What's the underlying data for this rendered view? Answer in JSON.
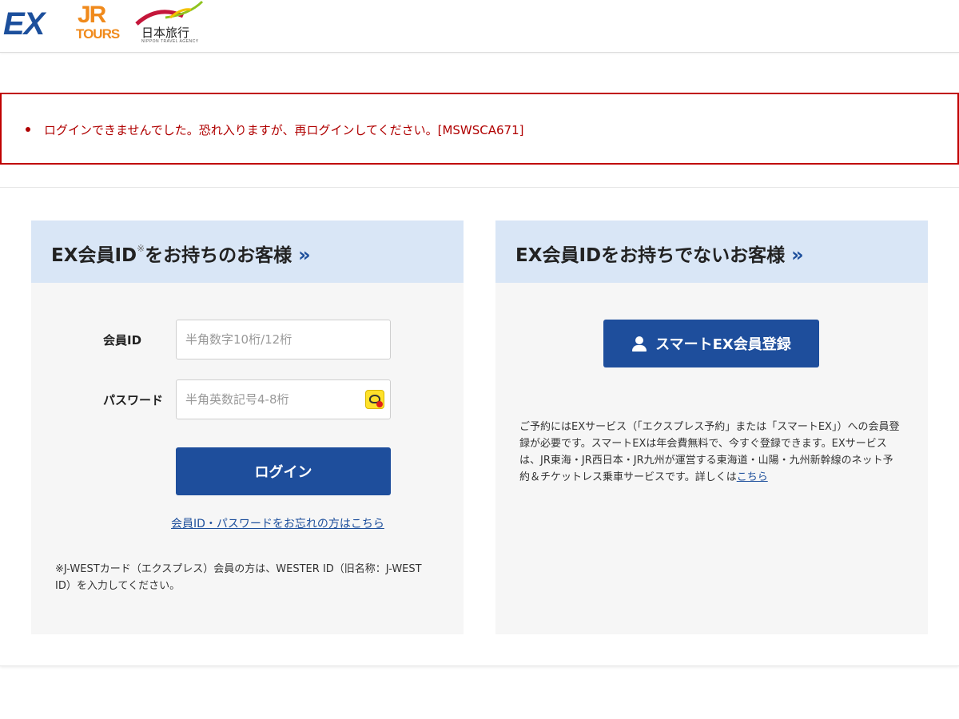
{
  "header": {
    "logos": {
      "ex": "EX",
      "jr": "JR",
      "tours": "TOURS",
      "ntv_kanji": "日本旅行",
      "ntv_sub": "NIPPON TRAVEL AGENCY"
    }
  },
  "error": {
    "message": "ログインできませんでした。恐れ入りますが、再ログインしてください。[MSWSCA671]",
    "color": "#b00000"
  },
  "login_panel": {
    "title_part1": "EX会員ID",
    "title_note": "※",
    "title_part2": "をお持ちのお客様",
    "chevron": "»",
    "member_id_label": "会員ID",
    "member_id_placeholder": "半角数字10桁/12桁",
    "password_label": "パスワード",
    "password_placeholder": "半角英数記号4-8桁",
    "password_toggle_icon": "eye-toggle-icon",
    "login_button": "ログイン",
    "forgot_link": "会員ID・パスワードをお忘れの方はこちら",
    "note": "※J-WESTカード（エクスプレス）会員の方は、WESTER ID（旧名称：J-WEST ID）を入力してください。"
  },
  "register_panel": {
    "title": "EX会員IDをお持ちでないお客様",
    "chevron": "»",
    "register_button": "スマートEX会員登録",
    "register_icon": "person-icon",
    "description": "ご予約にはEXサービス（「エクスプレス予約」または「スマートEX」）への会員登録が必要です。スマートEXは年会費無料で、今すぐ登録できます。EXサービスは、JR東海・JR西日本・JR九州が運営する東海道・山陽・九州新幹線のネット予約＆チケットレス乗車サービスです。詳しくは",
    "details_link": "こちら"
  },
  "colors": {
    "brand_blue": "#1e4e9c",
    "panel_head": "#d9e6f6",
    "panel_bg": "#f6f6f6",
    "error_border": "#c00000",
    "tours_orange": "#f08a1c"
  }
}
